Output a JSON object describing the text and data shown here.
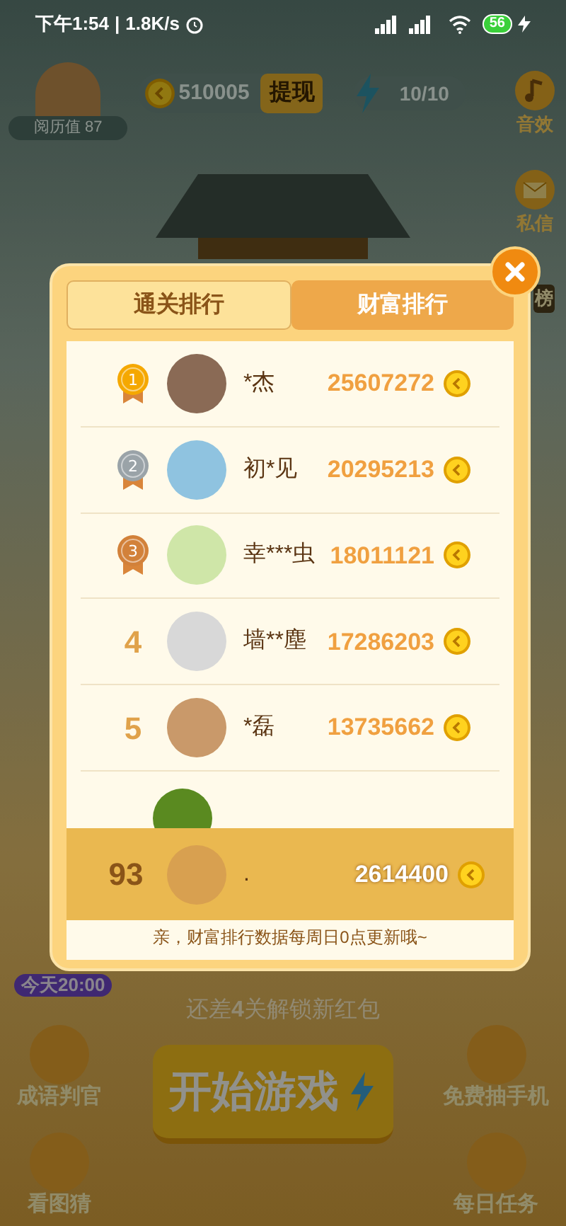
{
  "status_bar": {
    "time": "下午1:54",
    "separator": "|",
    "speed": "1.8K/s",
    "battery": "56"
  },
  "background": {
    "coins": "510005",
    "withdraw": "提现",
    "energy": "10/10",
    "experience": "阅历值 87",
    "side_buttons": [
      {
        "label": "音效",
        "kind": "music"
      },
      {
        "label": "私信",
        "kind": "mail"
      }
    ],
    "side_label": "榜",
    "timer_badge": "今天20:00",
    "unlock_hint": "还差**4**关解锁新红包",
    "start_button": "开始游戏",
    "features_left": [
      {
        "label": "成语判官"
      },
      {
        "label": "看图猜"
      }
    ],
    "features_right": [
      {
        "label": "免费抽手机"
      },
      {
        "label": "每日任务"
      }
    ]
  },
  "modal": {
    "tabs": [
      {
        "label": "通关排行",
        "selected": false
      },
      {
        "label": "财富排行",
        "selected": true
      }
    ],
    "rows": [
      {
        "kind": "medal",
        "rank": "1",
        "color": "#f5a800",
        "name": "*杰",
        "score": "25607272"
      },
      {
        "kind": "medal",
        "rank": "2",
        "color": "#9aa3a8",
        "name": "初*见",
        "score": "20295213"
      },
      {
        "kind": "medal",
        "rank": "3",
        "color": "#d2813a",
        "name": "幸***虫",
        "score": "18011121"
      },
      {
        "kind": "number",
        "rank": "4",
        "name": "墙**塵",
        "score": "17286203"
      },
      {
        "kind": "number",
        "rank": "5",
        "name": "*磊",
        "score": "13735662"
      }
    ],
    "my_row": {
      "rank": "93",
      "name": ".",
      "score": "2614400"
    },
    "notice": "亲，财富排行数据每周日0点更新哦~"
  }
}
